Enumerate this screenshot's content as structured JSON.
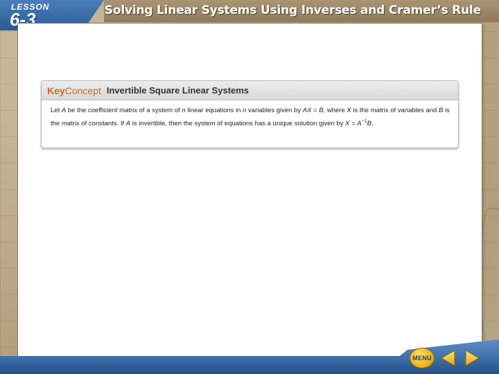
{
  "header": {
    "lesson_label": "LESSON",
    "lesson_number": "6-3",
    "title": "Solving Linear Systems Using Inverses and Cramer’s Rule"
  },
  "key_concept": {
    "key": "Key",
    "concept": "Concept",
    "title": "Invertible Square Linear Systems",
    "body": {
      "t1": "Let ",
      "A1": "A",
      "t2": " be the coefficient matrix of a system of ",
      "n1": "n",
      "t3": " linear equations in ",
      "n2": "n",
      "t4": " variables given by ",
      "AX": "AX",
      "eq1": " = ",
      "B1": "B",
      "t5": ", where ",
      "X1": "X",
      "t6": " is the matrix of variables and ",
      "B2": "B",
      "t7": " is the matrix of constants. If ",
      "A2": "A",
      "t8": " is invertible, then the system of equations has a unique solution given by ",
      "X2": "X",
      "eq2": " = ",
      "A3": "A",
      "exp": "−1",
      "B3": "B",
      "end": "."
    }
  },
  "nav": {
    "menu_label": "MENU",
    "prev_icon": "left-arrow-icon",
    "next_icon": "right-arrow-icon"
  },
  "colors": {
    "accent_orange": "#d46a1f",
    "header_blue": "#2a5a94",
    "background_tan": "#b9a788",
    "nav_yellow": "#f2b416"
  }
}
